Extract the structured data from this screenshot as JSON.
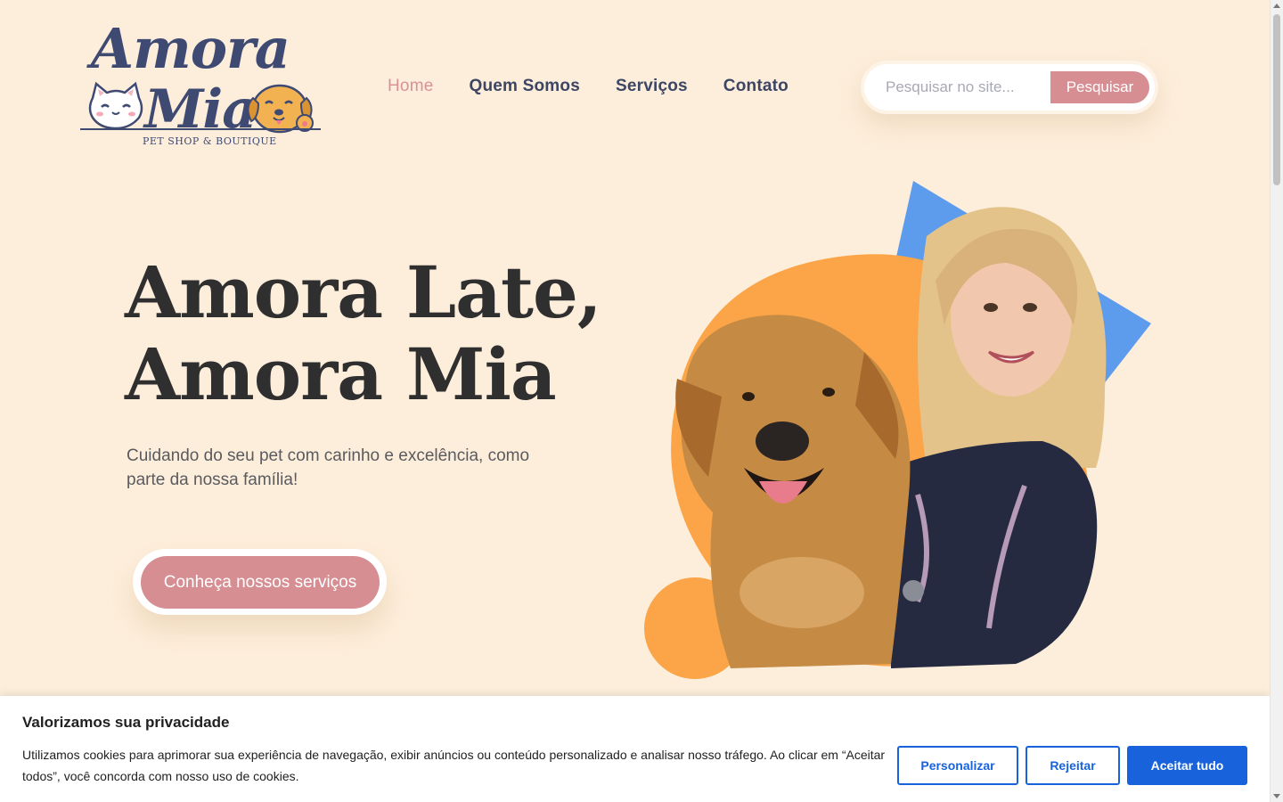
{
  "logo": {
    "line1": "Amora",
    "line2": "Mia",
    "tagline": "PET SHOP & BOUTIQUE"
  },
  "nav": {
    "items": [
      "Home",
      "Quem Somos",
      "Serviços",
      "Contato"
    ],
    "active": "Home"
  },
  "search": {
    "placeholder": "Pesquisar no site...",
    "button_label": "Pesquisar"
  },
  "hero": {
    "title_line1": "Amora Late,",
    "title_line2": "Amora Mia",
    "subtitle": "Cuidando do seu pet com carinho e excelência, como parte da nossa família!",
    "cta_label": "Conheça nossos serviços"
  },
  "cookie_banner": {
    "title": "Valorizamos sua privacidade",
    "text": "Utilizamos cookies para aprimorar sua experiência de navegação, exibir anúncios ou conteúdo personalizado e analisar nosso tráfego. Ao clicar em “Aceitar todos”, você concorda com nosso uso de cookies.",
    "customize_label": "Personalizar",
    "reject_label": "Rejeitar",
    "accept_label": "Aceitar tudo"
  },
  "colors": {
    "background": "#fdeedb",
    "accent_pink": "#d68e93",
    "navy": "#3d4564",
    "orange": "#fca548",
    "blue": "#5d9ced",
    "cookie_blue": "#1863dc"
  },
  "icons": {
    "logo_cat": "cat-icon",
    "logo_dog": "dog-icon"
  }
}
